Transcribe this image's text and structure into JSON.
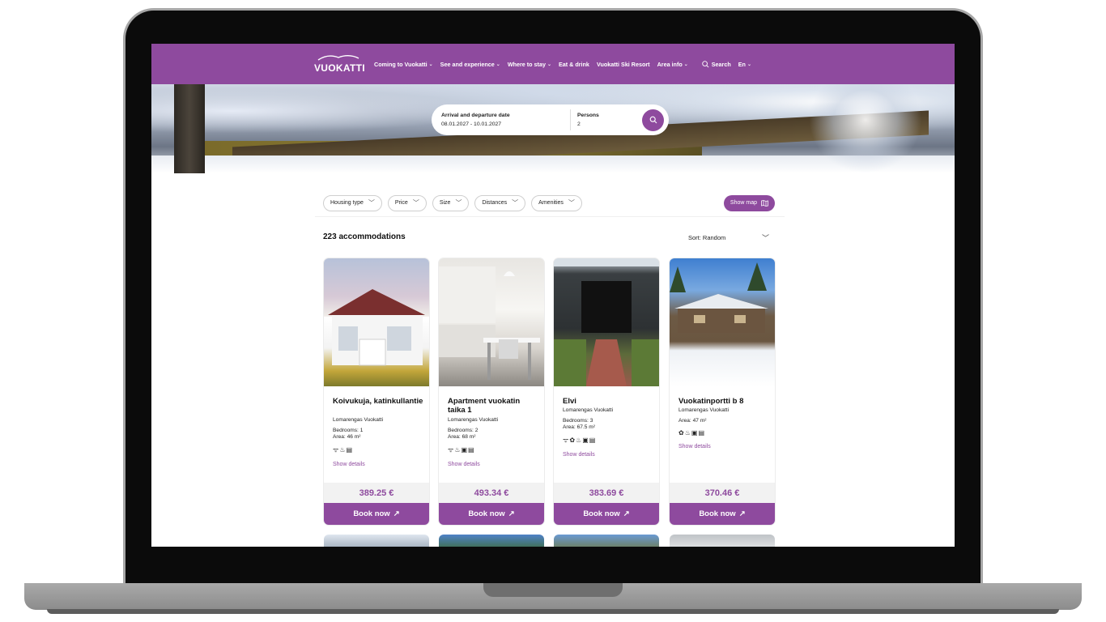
{
  "nav": {
    "logo": "VUOKATTI",
    "items": [
      "Coming to Vuokatti",
      "See and experience",
      "Where to stay",
      "Eat & drink",
      "Vuokatti Ski Resort",
      "Area info"
    ],
    "search_label": "Search",
    "language": "En"
  },
  "search": {
    "date_label": "Arrival and departure date",
    "date_value": "08.01.2027 - 10.01.2027",
    "persons_label": "Persons",
    "persons_value": "2"
  },
  "filters": {
    "chips": [
      "Housing type",
      "Price",
      "Size",
      "Distances",
      "Amenities"
    ],
    "map_button": "Show map"
  },
  "results": {
    "count_text": "223 accommodations",
    "sort_text": "Sort: Random"
  },
  "cards": [
    {
      "title": "Koivukuja, katinkullantie",
      "location": "Lomarengas Vuokatti",
      "specs": [
        "Bedrooms: 1",
        "Area: 46 m²"
      ],
      "icons": "wifi,fire,sauna",
      "details": "Show details",
      "price": "389.25 €",
      "book": "Book now"
    },
    {
      "title": "Apartment vuokatin taika 1",
      "location": "Lomarengas Vuokatti",
      "specs": [
        "Bedrooms: 2",
        "Area: 68 m²"
      ],
      "icons": "wifi,fire,dishwasher,sauna",
      "details": "Show details",
      "price": "493.34 €",
      "book": "Book now"
    },
    {
      "title": "Elvi",
      "location": "Lomarengas Vuokatti",
      "specs": [
        "Bedrooms: 3",
        "Area: 67.5 m²"
      ],
      "icons": "wifi,pet,fire,dishwasher,sauna",
      "details": "Show details",
      "price": "383.69 €",
      "book": "Book now"
    },
    {
      "title": "Vuokatinportti b 8",
      "location": "Lomarengas Vuokatti",
      "specs": [
        "Area: 47 m²"
      ],
      "icons": "pet,fire,dishwasher,sauna",
      "details": "Show details",
      "price": "370.46 €",
      "book": "Book now"
    }
  ],
  "colors": {
    "brand": "#8e4a9e",
    "price_bg": "#f2f2f2"
  }
}
